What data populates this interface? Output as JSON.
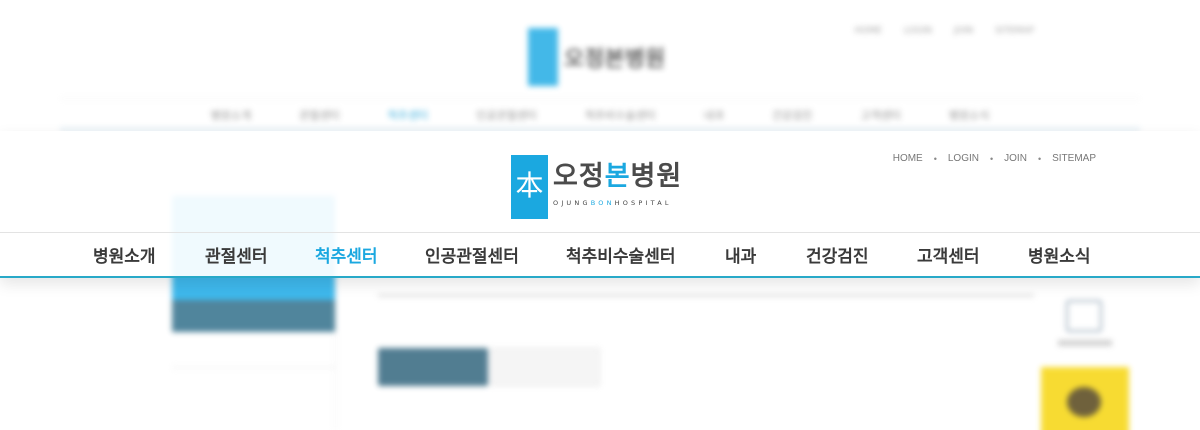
{
  "bg": {
    "logo_text": "오정본병원",
    "util_items": [
      "HOME",
      "LOGIN",
      "JOIN",
      "SITEMAP"
    ],
    "nav_items": [
      "병원소개",
      "관절센터",
      "척추센터",
      "인공관절센터",
      "척추비수술센터",
      "내과",
      "건강검진",
      "고객센터",
      "병원소식"
    ]
  },
  "header": {
    "logo": {
      "glyph": "本",
      "name_part1": "오정",
      "name_accent": "본",
      "name_part2": "병원",
      "sub_part1": "OJUNG",
      "sub_accent": "BON",
      "sub_part2": "HOSPITAL"
    },
    "util": {
      "home": "HOME",
      "login": "LOGIN",
      "join": "JOIN",
      "sitemap": "SITEMAP",
      "separator": "•"
    },
    "nav": {
      "items": [
        {
          "label": "병원소개"
        },
        {
          "label": "관절센터"
        },
        {
          "label": "척추센터",
          "active": true
        },
        {
          "label": "인공관절센터"
        },
        {
          "label": "척추비수술센터"
        },
        {
          "label": "내과"
        },
        {
          "label": "건강검진"
        },
        {
          "label": "고객센터"
        },
        {
          "label": "병원소식"
        }
      ]
    }
  },
  "colors": {
    "accent": "#1ba8e0",
    "nav_border": "#28a9c8",
    "kakao": "#f7d81c"
  }
}
